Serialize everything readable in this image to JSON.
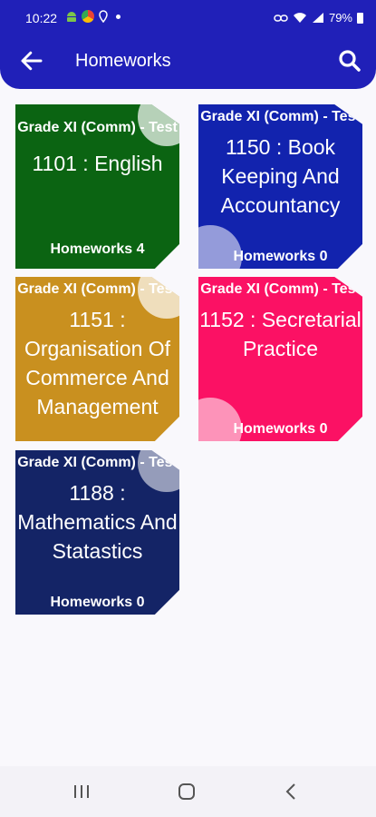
{
  "status": {
    "time": "10:22",
    "battery": "79%"
  },
  "header": {
    "title": "Homeworks"
  },
  "cards": [
    {
      "grade": "Grade XI (Comm) - Test",
      "subject": "1101 : English",
      "homeworks": "Homeworks 4",
      "color": "#0b6412"
    },
    {
      "grade": "Grade XI (Comm) - Test",
      "subject": "1150 : Book Keeping And Accountancy",
      "homeworks": "Homeworks 0",
      "color": "#1223ae"
    },
    {
      "grade": "Grade XI (Comm) - Test",
      "subject": "1151 : Organisation Of Commerce And Management",
      "homeworks": "Homeworks 0",
      "color": "#c9901f"
    },
    {
      "grade": "Grade XI (Comm) - Test",
      "subject": "1152 : Secretarial Practice",
      "homeworks": "Homeworks 0",
      "color": "#fb1164"
    },
    {
      "grade": "Grade XI (Comm) - Test",
      "subject": "1188 : Mathematics And Statastics",
      "homeworks": "Homeworks 0",
      "color": "#142466"
    }
  ],
  "icons": {
    "back": "arrow-left-icon",
    "search": "search-icon",
    "recents": "recents-icon",
    "home": "home-icon",
    "navback": "chevron-left-icon"
  }
}
